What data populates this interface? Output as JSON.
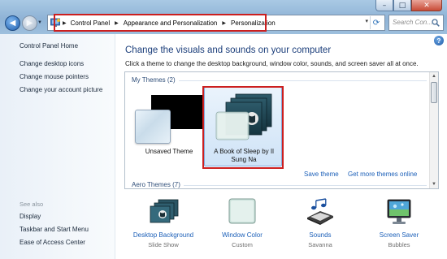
{
  "window": {
    "minimize_glyph": "–",
    "maximize_glyph": "□",
    "close_glyph": "✕"
  },
  "address_bar": {
    "breadcrumbs": [
      "Control Panel",
      "Appearance and Personalization",
      "Personalization"
    ],
    "separator": "▶",
    "dropdown_glyph": "▾",
    "refresh_glyph": "⟳"
  },
  "search": {
    "placeholder": "Search Con..."
  },
  "left_pane": {
    "home_link": "Control Panel Home",
    "links": [
      "Change desktop icons",
      "Change mouse pointers",
      "Change your account picture"
    ],
    "see_also_title": "See also",
    "see_also_links": [
      "Display",
      "Taskbar and Start Menu",
      "Ease of Access Center"
    ]
  },
  "help_glyph": "?",
  "main": {
    "title": "Change the visuals and sounds on your computer",
    "description": "Click a theme to change the desktop background, window color, sounds, and screen saver all at once."
  },
  "themes": {
    "my_themes_header": "My Themes (2)",
    "aero_themes_header": "Aero Themes (7)",
    "items": [
      {
        "label": "Unsaved Theme",
        "selected": false
      },
      {
        "label_line1": "A Book of Sleep by Il",
        "label_line2": "Sung Na",
        "selected": true
      }
    ],
    "save_theme": "Save theme",
    "get_more": "Get more themes online"
  },
  "bottom": [
    {
      "label": "Desktop Background",
      "sub": "Slide Show",
      "icon": "desktop-background-icon"
    },
    {
      "label": "Window Color",
      "sub": "Custom",
      "icon": "window-color-icon"
    },
    {
      "label": "Sounds",
      "sub": "Savanna",
      "icon": "sounds-icon"
    },
    {
      "label": "Screen Saver",
      "sub": "Bubbles",
      "icon": "screen-saver-icon"
    }
  ],
  "colors": {
    "link": "#1b5fb8",
    "title": "#1a3d7a",
    "highlight_red": "#cc1f1f"
  }
}
